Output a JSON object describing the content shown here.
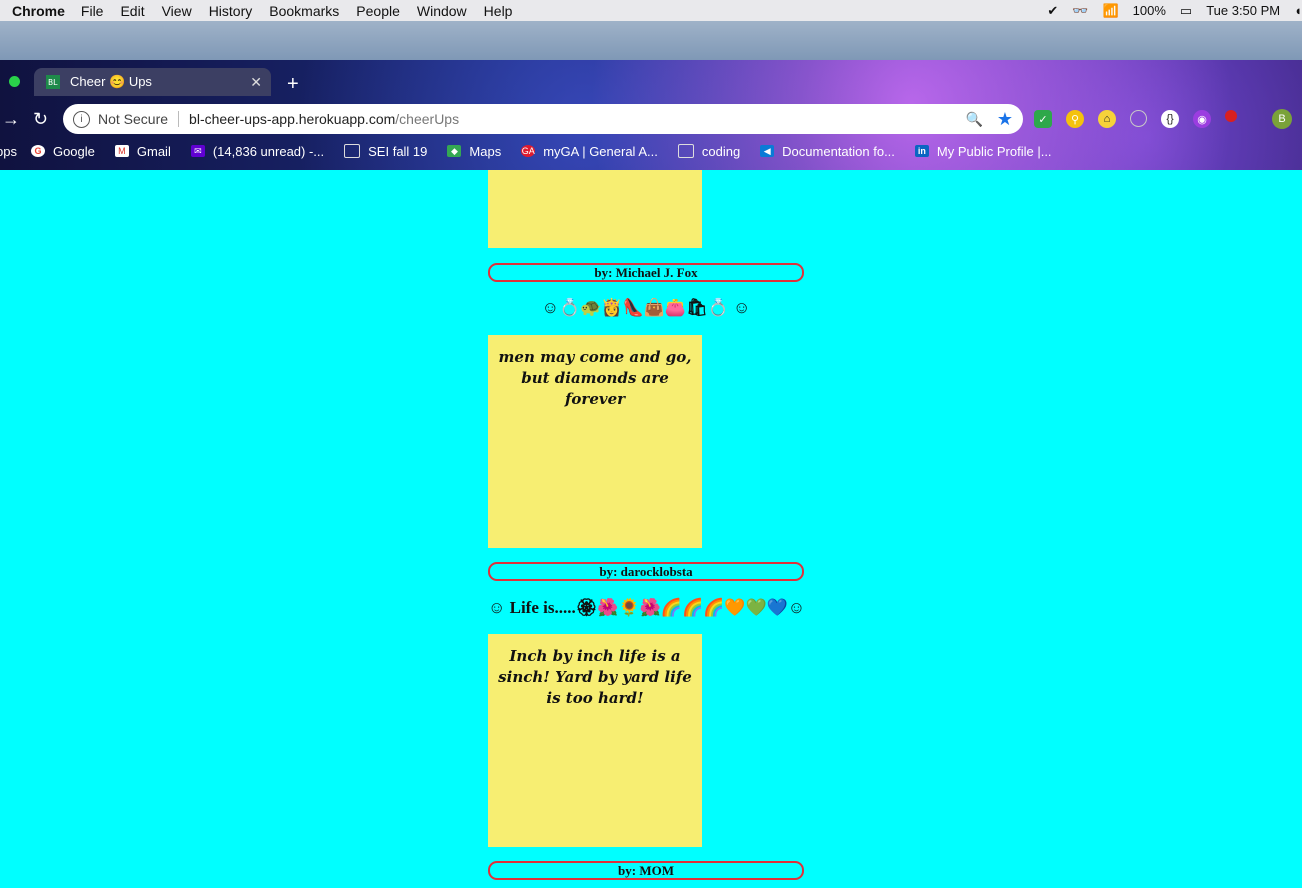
{
  "menubar": {
    "app": "Chrome",
    "items": [
      "File",
      "Edit",
      "View",
      "History",
      "Bookmarks",
      "People",
      "Window",
      "Help"
    ],
    "battery": "100%",
    "clock": "Tue 3:50 PM"
  },
  "tab": {
    "title": "Cheer 😊 Ups",
    "favicon": "BL"
  },
  "address": {
    "security": "Not Secure",
    "host": "bl-cheer-ups-app.herokuapp.com",
    "path": "/cheerUps"
  },
  "profile_initial": "B",
  "bookmarks": [
    {
      "label": "pps",
      "icon": "apps-icon",
      "color": "#4a6bd8"
    },
    {
      "label": "Google",
      "icon": "google-icon",
      "color": "#ea4335"
    },
    {
      "label": "Gmail",
      "icon": "gmail-icon",
      "color": "#d93025"
    },
    {
      "label": "(14,836 unread) -...",
      "icon": "yahoo-mail-icon",
      "color": "#6001d2"
    },
    {
      "label": "SEI fall 19",
      "icon": "folder-icon",
      "color": "#c9d1e8"
    },
    {
      "label": "Maps",
      "icon": "maps-icon",
      "color": "#34a853"
    },
    {
      "label": "myGA | General A...",
      "icon": "ga-icon",
      "color": "#e01b2f"
    },
    {
      "label": "coding",
      "icon": "folder-icon",
      "color": "#c9d1e8"
    },
    {
      "label": "Documentation fo...",
      "icon": "vscode-icon",
      "color": "#0a7bd6"
    },
    {
      "label": "My Public Profile |...",
      "icon": "linkedin-icon",
      "color": "#0a66c2"
    }
  ],
  "cheerups": [
    {
      "author": "by: Michael J. Fox"
    },
    {
      "title": "☺💍🐢👸👠👜👛🛍💍 ☺",
      "text": "men may come and go, but diamonds are forever",
      "author": "by: darocklobsta"
    },
    {
      "title": "☺ Life is.....🏵🌺🌻🌺🌈🌈🌈🧡💚💙☺",
      "text": "Inch by inch life is a sinch! Yard by yard life is too hard!",
      "author": "by: MOM"
    }
  ]
}
